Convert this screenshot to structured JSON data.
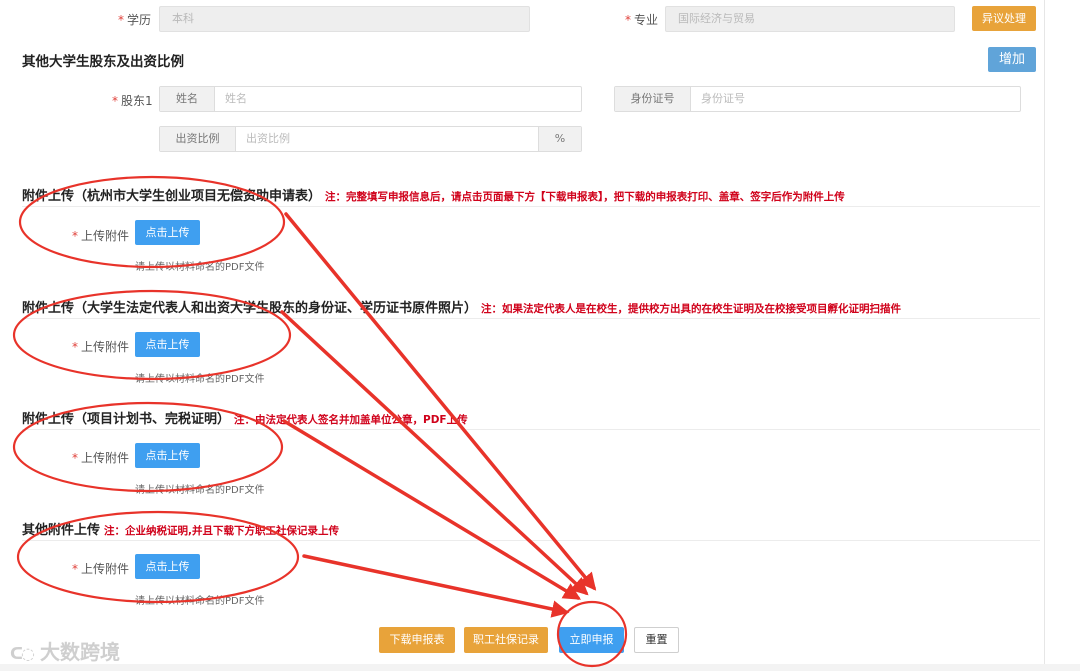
{
  "form": {
    "education": {
      "label": "学历",
      "value": "本科"
    },
    "major": {
      "label": "专业",
      "value": "国际经济与贸易"
    },
    "objection_button": "异议处理",
    "shareholders_section": {
      "title": "其他大学生股东及出资比例",
      "add_button": "增加",
      "shareholder_label": "股东1",
      "name_addon": "姓名",
      "name_placeholder": "姓名",
      "id_addon": "身份证号",
      "id_placeholder": "身份证号",
      "ratio_addon": "出资比例",
      "ratio_placeholder": "出资比例",
      "ratio_unit": "%"
    },
    "attachments": [
      {
        "title": "附件上传（杭州市大学生创业项目无偿资助申请表）",
        "note": "注：完整填写申报信息后，请点击页面最下方【下载申报表】，把下载的申报表打印、盖章、签字后作为附件上传",
        "field_label": "上传附件",
        "button": "点击上传",
        "hint": "请上传以材料命名的PDF文件"
      },
      {
        "title": "附件上传（大学生法定代表人和出资大学生股东的身份证、学历证书原件照片）",
        "note": "注：如果法定代表人是在校生，提供校方出具的在校生证明及在校接受项目孵化证明扫描件",
        "field_label": "上传附件",
        "button": "点击上传",
        "hint": "请上传以材料命名的PDF文件"
      },
      {
        "title": "附件上传（项目计划书、完税证明）",
        "note": "注：由法定代表人签名并加盖单位公章，PDF上传",
        "field_label": "上传附件",
        "button": "点击上传",
        "hint": "请上传以材料命名的PDF文件"
      },
      {
        "title": "其他附件上传",
        "note": "注：企业纳税证明,并且下载下方职工社保记录上传",
        "field_label": "上传附件",
        "button": "点击上传",
        "hint": "请上传以材料命名的PDF文件"
      }
    ],
    "footer_buttons": {
      "download": "下载申报表",
      "social_security": "职工社保记录",
      "submit": "立即申报",
      "reset": "重置"
    }
  },
  "watermark": "大数跨境",
  "colors": {
    "annotation_red": "#e8332a",
    "note_red": "#d0021b",
    "primary_blue": "#3f9ff0",
    "orange": "#e8a33a",
    "steel_blue": "#60a4d9"
  }
}
